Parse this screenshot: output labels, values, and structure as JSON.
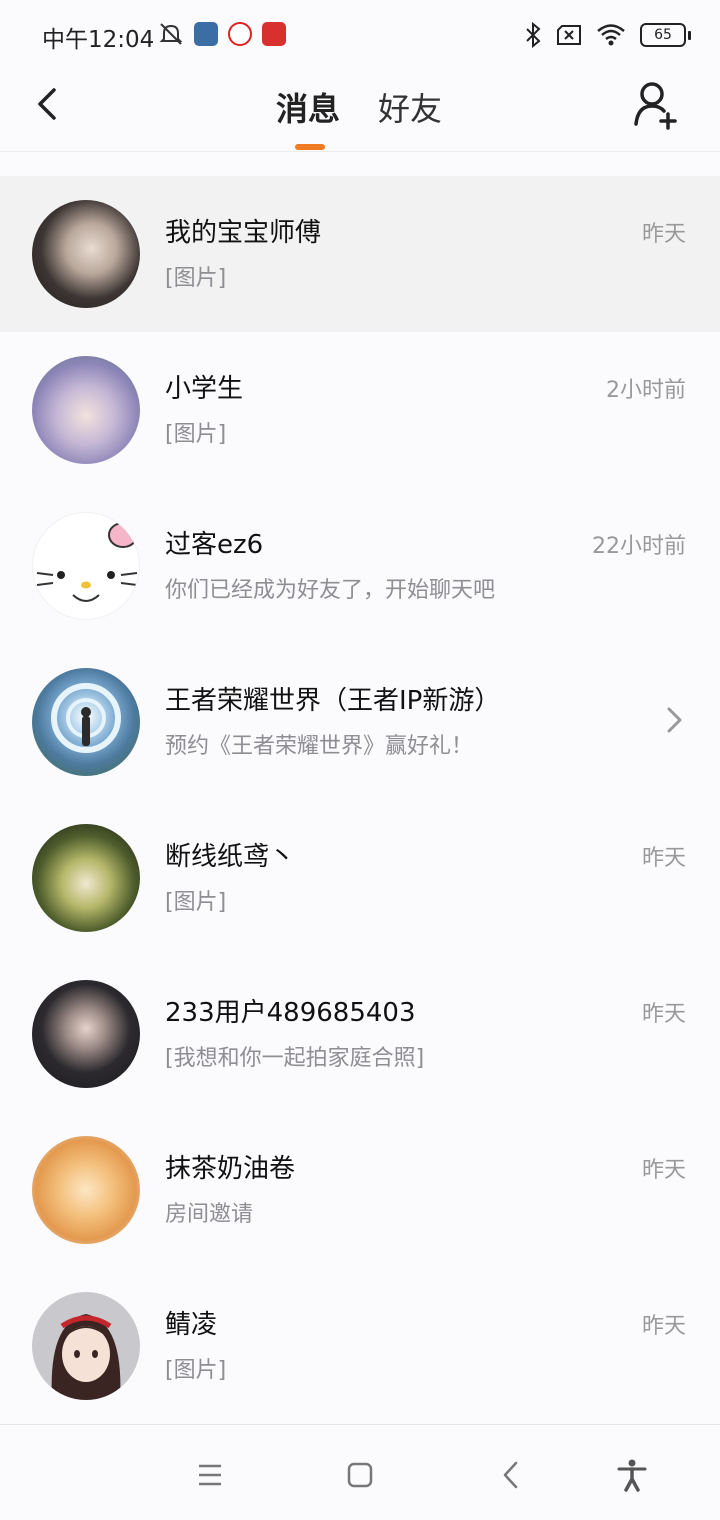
{
  "status_bar": {
    "time": "中午12:04",
    "battery": "65",
    "icons_left": [
      "bell-off-icon",
      "settings-app-icon",
      "video-app-icon",
      "red-app-icon"
    ],
    "icons_right": [
      "bluetooth-icon",
      "sim-off-icon",
      "wifi-icon",
      "battery-icon"
    ]
  },
  "header": {
    "tabs": [
      {
        "label": "消息",
        "active": true
      },
      {
        "label": "好友",
        "active": false
      }
    ],
    "accent_color": "#f07b22"
  },
  "conversations": [
    {
      "name": "我的宝宝师傅",
      "preview": "[图片]",
      "time": "昨天",
      "highlighted": true
    },
    {
      "name": "小学生",
      "preview": "[图片]",
      "time": "2小时前"
    },
    {
      "name": "过客ez6",
      "preview": "你们已经成为好友了，开始聊天吧",
      "time": "22小时前"
    },
    {
      "name": "王者荣耀世界（王者IP新游）",
      "preview": "预约《王者荣耀世界》赢好礼！",
      "time": "",
      "has_chevron": true
    },
    {
      "name": "断线纸鸢丶",
      "preview": "[图片]",
      "time": "昨天"
    },
    {
      "name": "233用户489685403",
      "preview": "[我想和你一起拍家庭合照]",
      "time": "昨天"
    },
    {
      "name": "抹茶奶油卷",
      "preview": "房间邀请",
      "time": "昨天"
    },
    {
      "name": "鲭凌",
      "preview": "[图片]",
      "time": "昨天"
    }
  ],
  "nav_bar": {
    "icons": [
      "menu-icon",
      "home-icon",
      "back-icon",
      "accessibility-icon"
    ]
  }
}
